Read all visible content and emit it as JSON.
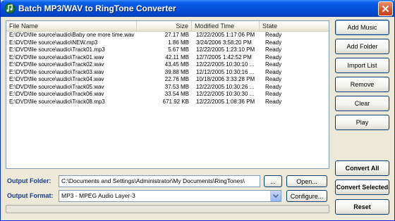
{
  "window": {
    "title": "Batch MP3/WAV to RingTone Converter"
  },
  "list": {
    "columns": {
      "name": "File Name",
      "size": "Size",
      "modified": "Modified Time",
      "state": "State"
    },
    "rows": [
      {
        "name": "E:\\DVD\\file source\\audio\\Baby one more time.wav",
        "size": "27.17 MB",
        "modified": "12/22/2005 1:17:06 PM",
        "state": "Ready"
      },
      {
        "name": "E:\\DVD\\file source\\audio\\NEW.mp3",
        "size": "1.86 MB",
        "modified": "3/24/2006 3:58:20 PM",
        "state": "Ready"
      },
      {
        "name": "E:\\DVD\\file source\\audio\\Track01.mp3",
        "size": "5.67 MB",
        "modified": "12/22/2005 1:23:10 PM",
        "state": "Ready"
      },
      {
        "name": "E:\\DVD\\file source\\audio\\Track01.wav",
        "size": "42.11 MB",
        "modified": "12/7/2005 1:42:52 PM",
        "state": "Ready"
      },
      {
        "name": "E:\\DVD\\file source\\audio\\Track02.wav",
        "size": "43.45 MB",
        "modified": "12/22/2005 10:30:10 ...",
        "state": "Ready"
      },
      {
        "name": "E:\\DVD\\file source\\audio\\Track03.wav",
        "size": "39.88 MB",
        "modified": "12/12/2005 10:30:16 ...",
        "state": "Ready"
      },
      {
        "name": "E:\\DVD\\file source\\audio\\Track04.wav",
        "size": "22.76 MB",
        "modified": "10/18/2006 3:33:28 PM",
        "state": "Ready"
      },
      {
        "name": "E:\\DVD\\file source\\audio\\Track05.wav",
        "size": "37.53 MB",
        "modified": "12/22/2005 10:30:26 ...",
        "state": "Ready"
      },
      {
        "name": "E:\\DVD\\file source\\audio\\Track06.wav",
        "size": "33.54 MB",
        "modified": "12/22/2005 10:30:30 ...",
        "state": "Ready"
      },
      {
        "name": "E:\\DVD\\file source\\audio\\Track08.mp3",
        "size": "671.92 KB",
        "modified": "12/22/2005 1:08:36 PM",
        "state": "Ready"
      }
    ]
  },
  "output": {
    "folder_label": "Output Folder:",
    "folder_value": "C:\\Documents and Settings\\Administrator\\My Documents\\RingTones\\",
    "browse_label": "...",
    "open_label": "Open...",
    "format_label": "Output Format:",
    "format_value": "MP3 - MPEG Audio Layer-3",
    "configure_label": "Configure..."
  },
  "buttons": {
    "add_music": "Add Music",
    "add_folder": "Add Folder",
    "import_list": "Import List",
    "remove": "Remove",
    "clear": "Clear",
    "play": "Play",
    "convert_all": "Convert All",
    "convert_selected": "Convert Selected",
    "reset": "Reset"
  },
  "progress": {
    "value": 0
  },
  "icons": {
    "app": "music-note-icon",
    "close": "close-icon",
    "dropdown": "chevron-down-icon"
  }
}
